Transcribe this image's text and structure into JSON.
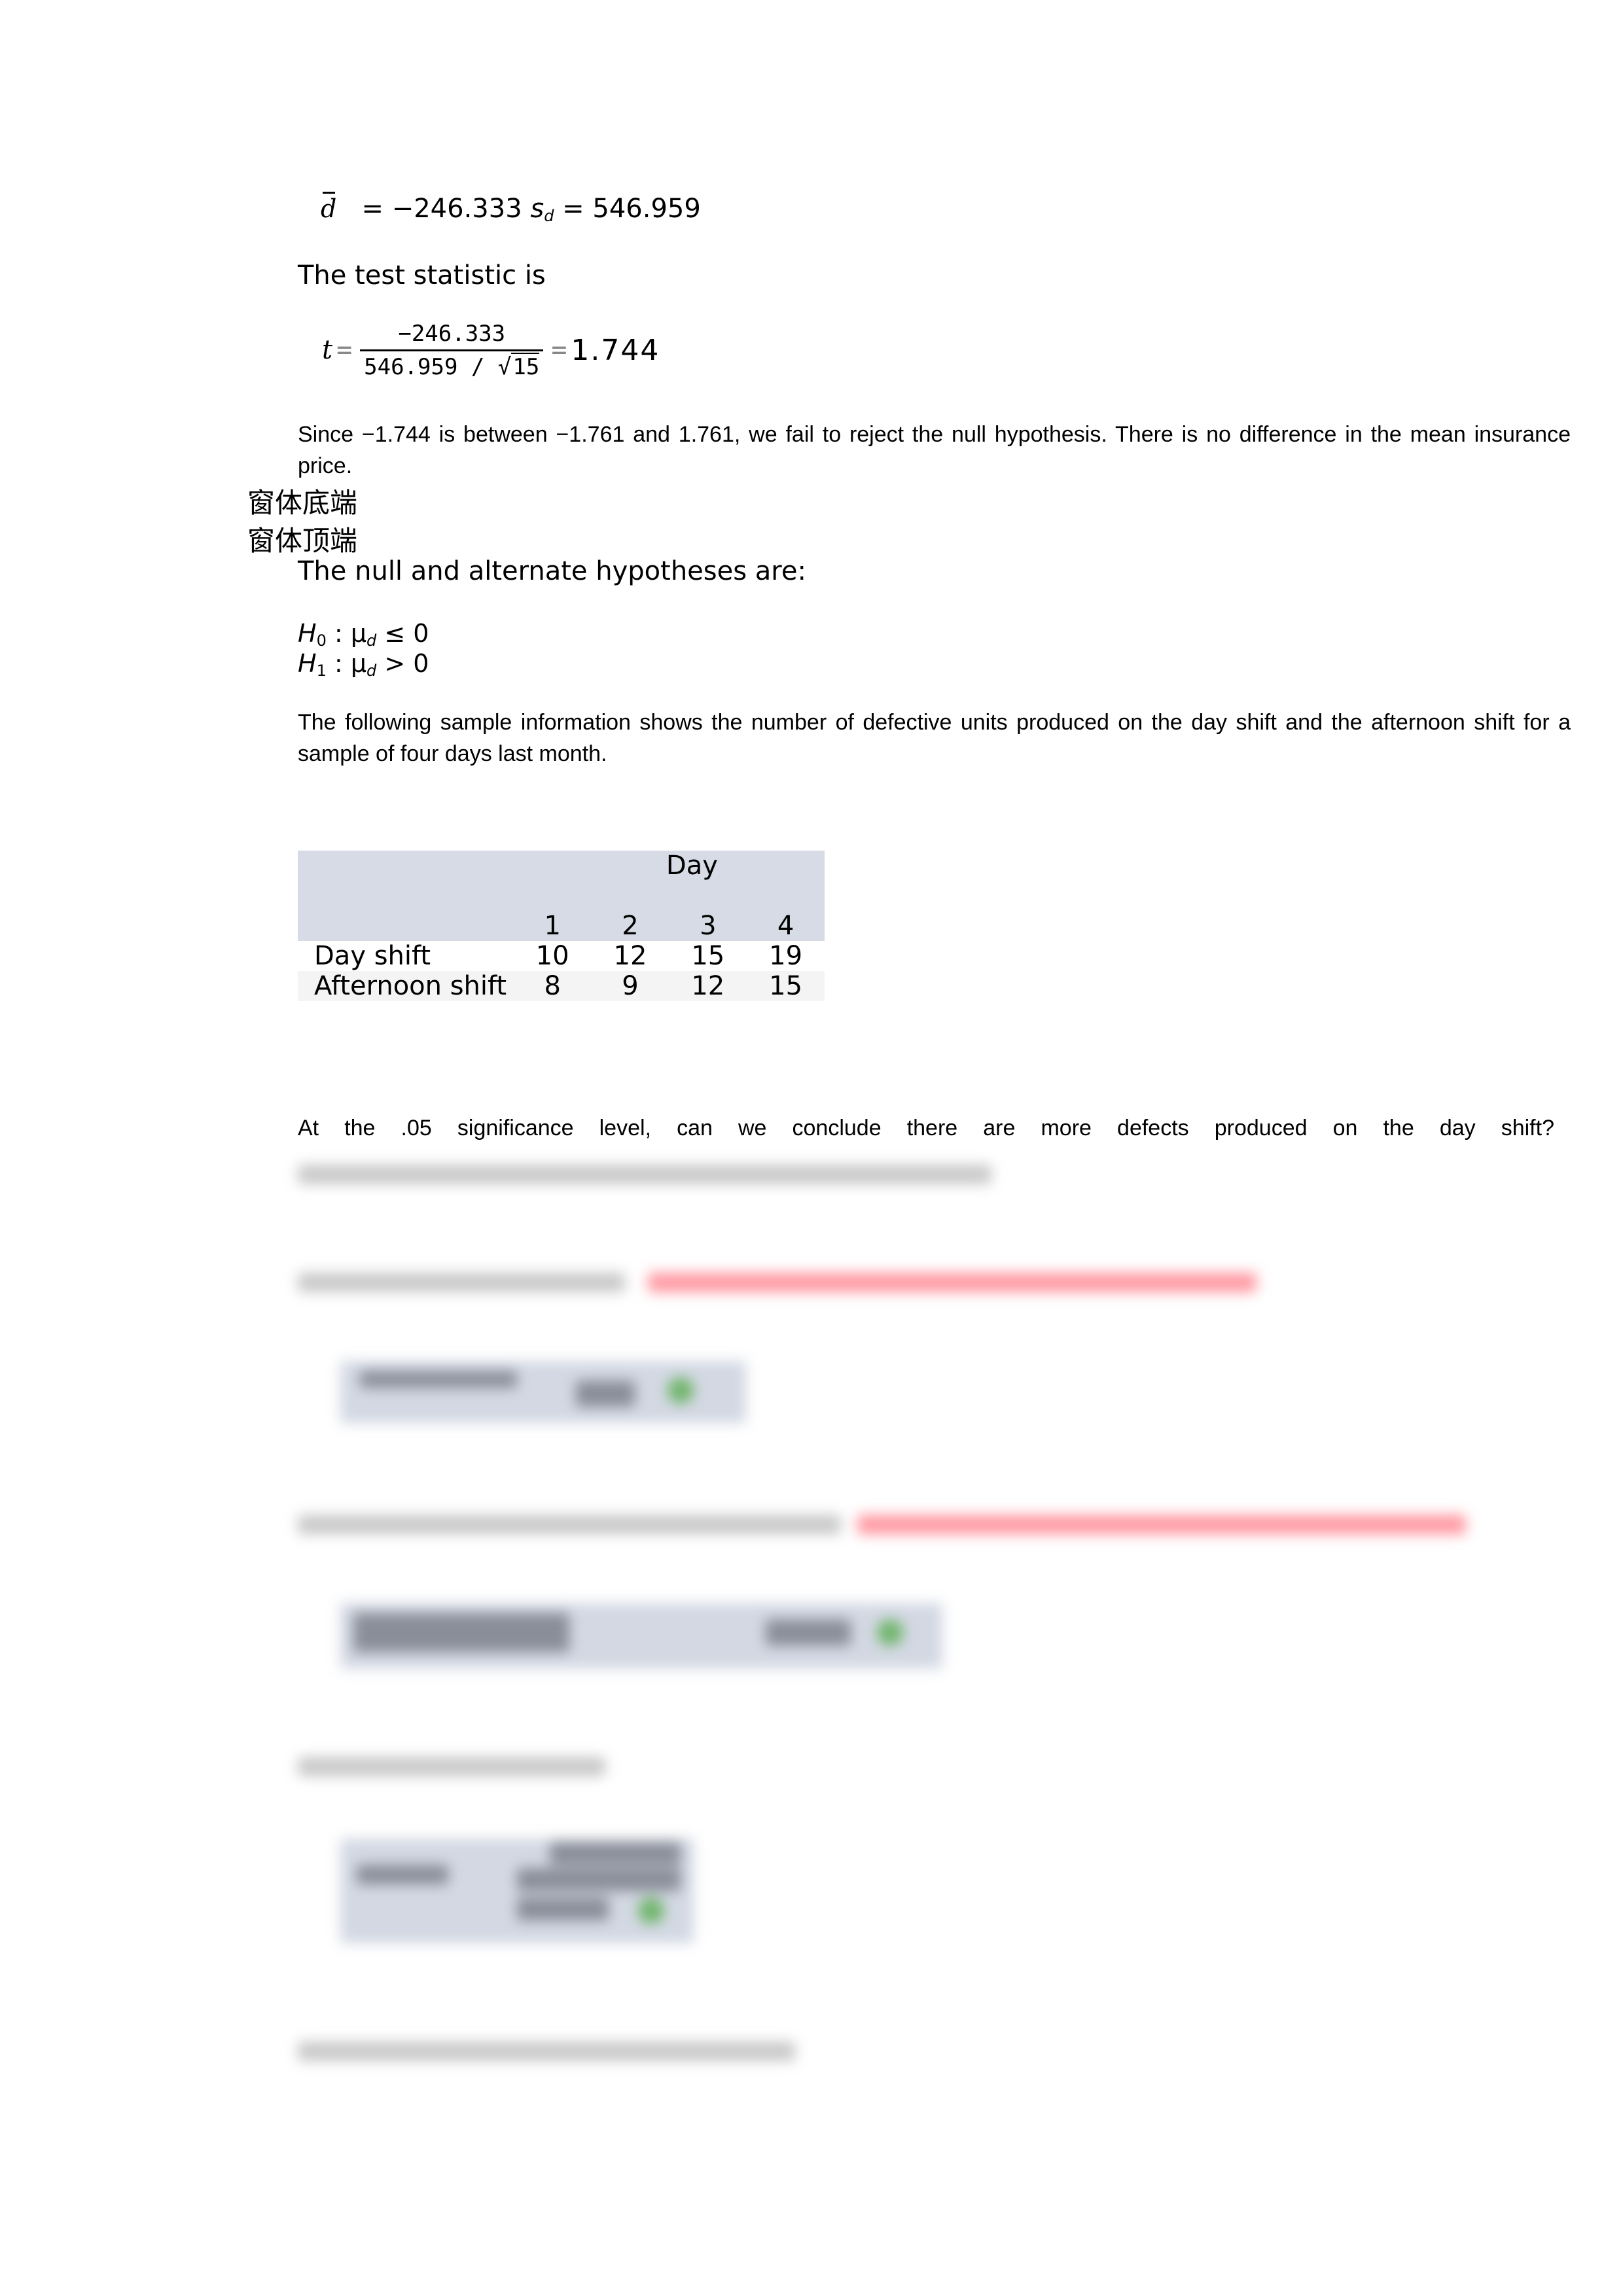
{
  "dbar_line": {
    "symbol": "d",
    "equals_mean": "= −246.333",
    "sd_symbol": "s",
    "sd_subscript": "d",
    "equals_sd": "= 546.959"
  },
  "test_statistic_label": "The test statistic is",
  "formula": {
    "t": "t",
    "equals": "=",
    "numerator": "−246.333",
    "denominator_prefix": "546.959 / ",
    "sqrt_symbol": "√",
    "sqrt_arg": "15",
    "result": "1.744"
  },
  "conclusion": "Since −1.744 is between −1.761 and 1.761, we fail to reject the null hypothesis. There is no difference in the mean insurance price.",
  "form_markers": {
    "bottom": "窗体底端",
    "top": "窗体顶端"
  },
  "hypotheses": {
    "label": "The null and alternate hypotheses are:",
    "h0": {
      "H": "H",
      "sub": "0",
      "mu": " : μ",
      "mu_sub": "d",
      "rel": " ≤ 0"
    },
    "h1": {
      "H": "H",
      "sub": "1",
      "mu": " : μ",
      "mu_sub": "d",
      "rel": " > 0"
    }
  },
  "sample_info": "The following sample information shows the number of defective units produced on the day shift and the afternoon shift for a sample of four days last month.",
  "table": {
    "group_header": "Day",
    "day_headers": [
      "1",
      "2",
      "3",
      "4"
    ],
    "rows": [
      {
        "label": "Day shift",
        "values": [
          "10",
          "12",
          "15",
          "19"
        ]
      },
      {
        "label": "Afternoon shift",
        "values": [
          "8",
          "9",
          "12",
          "15"
        ]
      }
    ]
  },
  "question": "At the .05 significance level, can we conclude there are more defects produced on the day shift?",
  "colors": {
    "table_header_bg": "#d6dbe5",
    "table_alt_row_bg": "#f4f4f4",
    "blurred_instruction_red": "#ff9aa3",
    "blurred_check_green": "#6fb56a"
  }
}
